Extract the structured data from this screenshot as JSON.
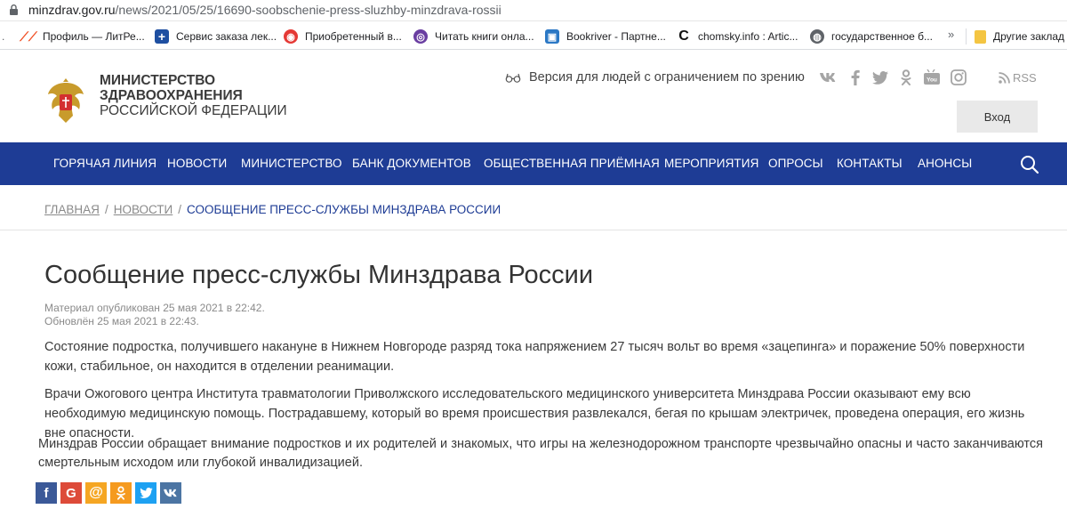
{
  "browser": {
    "url_host": "minzdrav.gov.ru",
    "url_path": "/news/2021/05/25/16690-soobschenie-press-sluzhby-minzdrava-rossii"
  },
  "bookmarks": {
    "items": [
      {
        "label": "Профиль — ЛитРе...",
        "icon": "litres-icon"
      },
      {
        "label": "Сервис заказа лек...",
        "icon": "medical-cross-icon"
      },
      {
        "label": "Приобретенный в...",
        "icon": "book-store-icon"
      },
      {
        "label": "Читать книги онла...",
        "icon": "read-books-icon"
      },
      {
        "label": "Bookriver - Партне...",
        "icon": "bookriver-icon"
      },
      {
        "label": "chomsky.info : Artic...",
        "icon": "chomsky-icon"
      },
      {
        "label": "государственное б...",
        "icon": "globe-icon"
      }
    ],
    "overflow": "»",
    "other": "Другие заклад"
  },
  "header": {
    "logo_line1": "Министерство",
    "logo_line2": "здравоохранения",
    "logo_line3": "Российской Федерации",
    "vision_label": "Версия для людей с ограничением по зрению",
    "rss_label": "RSS",
    "login_label": "Вход",
    "social": [
      "vk-icon",
      "facebook-icon",
      "twitter-icon",
      "odnoklassniki-icon",
      "youtube-icon",
      "instagram-icon"
    ]
  },
  "nav": {
    "items": [
      "Горячая линия",
      "Новости",
      "Министерство",
      "Банк документов",
      "Общественная приёмная",
      "Мероприятия",
      "Опросы",
      "Контакты",
      "Анонсы"
    ]
  },
  "breadcrumbs": {
    "home": "Главная",
    "news": "Новости",
    "current": "Сообщение пресс-службы Минздрава России",
    "separator": "/"
  },
  "article": {
    "title": "Сообщение пресс-службы Минздрава России",
    "published": "Материал опубликован 25 мая 2021 в 22:42.",
    "updated": "Обновлён 25 мая 2021 в 22:43.",
    "p1": "Состояние подростка, получившего накануне в Нижнем Новгороде разряд тока напряжением 27 тысяч вольт во время «зацепинга» и поражение 50% поверхности кожи, стабильное, он находится в отделении реанимации.",
    "p2": "Врачи Ожогового центра Института травматологии Приволжского исследовательского медицинского университета Минздрава России оказывают ему всю необходимую медицинскую помощь. Пострадавшему, который во время происшествия развлекался, бегая по крышам электричек, проведена операция, его жизнь вне опасности.",
    "p3": "Минздрав России обращает внимание подростков и их родителей и знакомых, что игры на железнодорожном транспорте чрезвычайно опасны и часто заканчиваются смертельным исходом или глубокой инвалидизацией."
  },
  "share": {
    "buttons": [
      {
        "icon": "facebook-share-icon",
        "glyph": "f",
        "color": "#3b5998"
      },
      {
        "icon": "google-share-icon",
        "glyph": "G",
        "color": "#dd4b39"
      },
      {
        "icon": "mailru-share-icon",
        "glyph": "@",
        "color": "#f5a623"
      },
      {
        "icon": "odnoklassniki-share-icon",
        "glyph": "ok",
        "color": "#f59a1f"
      },
      {
        "icon": "twitter-share-icon",
        "glyph": "t",
        "color": "#1da1f2"
      },
      {
        "icon": "vk-share-icon",
        "glyph": "vk",
        "color": "#4c75a3"
      }
    ]
  },
  "colors": {
    "nav_background": "#1e3c95",
    "breadcrumb_current": "#1e3c95",
    "social_icons": "#a5a5a5",
    "login_background": "#e9e9e9"
  }
}
